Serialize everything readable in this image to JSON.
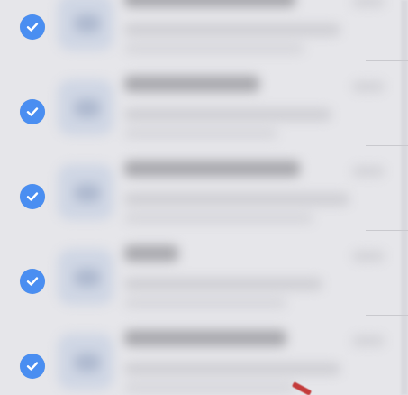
{
  "list": {
    "row_count": 5,
    "items": [
      {
        "selected": true
      },
      {
        "selected": true
      },
      {
        "selected": true
      },
      {
        "selected": true
      },
      {
        "selected": true
      }
    ]
  },
  "colors": {
    "background": "#e6e6ea",
    "checkmark_fill": "#4a8ef1",
    "pointer_accent": "#c43b3b"
  },
  "icons": {
    "selected": "checkmark-circle-icon",
    "pointer": "red-pointer-icon"
  }
}
